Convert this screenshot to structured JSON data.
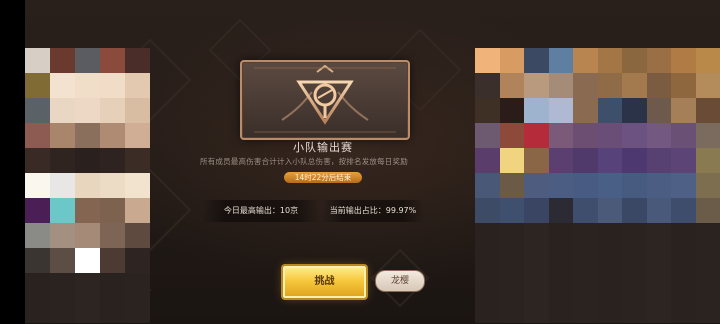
{
  "event": {
    "title": "小队输出赛",
    "description": "所有成员最高伤害合计计入小队总伤害，按排名发放每日奖励",
    "timer": "14时22分后结束"
  },
  "stats": {
    "daily_highest": "今日最高输出：10京",
    "current_share": "当前输出占比：99.97%"
  },
  "buttons": {
    "primary": "挑战",
    "secondary": "龙樱"
  },
  "colors": {
    "background": "#2a201b",
    "accent_gold": "#f6c83c",
    "timer_orange": "#d88a2a"
  }
}
